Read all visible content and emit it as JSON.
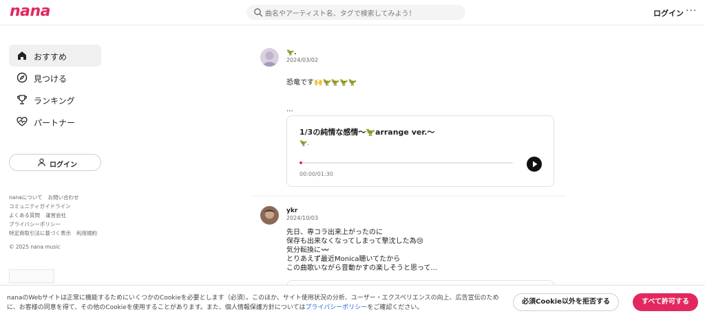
{
  "header": {
    "logo": "nana",
    "search_placeholder": "曲名やアーティスト名、タグで検索してみよう！",
    "login": "ログイン",
    "more": "···"
  },
  "sidebar": {
    "items": [
      {
        "label": "おすすめ",
        "icon": "home-icon",
        "active": true
      },
      {
        "label": "見つける",
        "icon": "compass-icon",
        "active": false
      },
      {
        "label": "ランキング",
        "icon": "trophy-icon",
        "active": false
      },
      {
        "label": "パートナー",
        "icon": "heart-pulse-icon",
        "active": false
      }
    ],
    "login_button": "ログイン",
    "footer_links": [
      [
        "nanaについて",
        "お問い合わせ"
      ],
      [
        "コミュニティガイドライン"
      ],
      [
        "よくある質問",
        "運営会社"
      ],
      [
        "プライバシーポリシー"
      ],
      [
        "特定商取引法に基づく表示",
        "利用規約"
      ]
    ],
    "copyright": "© 2025 nana music"
  },
  "feed": {
    "posts": [
      {
        "user": "🦖.",
        "date": "2024/03/02",
        "text": "恐竜です🙌🦖🦖🦖🦖\n\n\n...",
        "card": {
          "title": "1/3の純情な感情〜🦖arrange ver.〜",
          "artist": "🦖.",
          "time": "00:00/01:30",
          "progress": 0.0
        }
      },
      {
        "user": "ykr",
        "date": "2024/10/03",
        "text": "先日、専コラ出来上がったのに\n保存も出来なくなってしまって撃沈した為😢\n気分転換に〰️\nとりあえず最近Monica聴いてたから\nこの曲歌いながら音動かすの楽しそうと思って..."
      }
    ]
  },
  "cookie": {
    "text_before_link": "nanaのWebサイトは正常に機能するためにいくつかのCookieを必要とします（必須）。このほか、サイト使用状況の分析、ユーザー・エクスペリエンスの向上、広告宣伝のために、お客様の同意を得て、その他のCookieを使用することがあります。また、個人情報保護方針については",
    "link": "プライバシーポリシー",
    "text_after_link": "をご確認ください。",
    "reject_button": "必須Cookie以外を拒否する",
    "accept_button": "すべて許可する"
  },
  "colors": {
    "brand": "#e2285f",
    "link": "#2a62d4"
  }
}
